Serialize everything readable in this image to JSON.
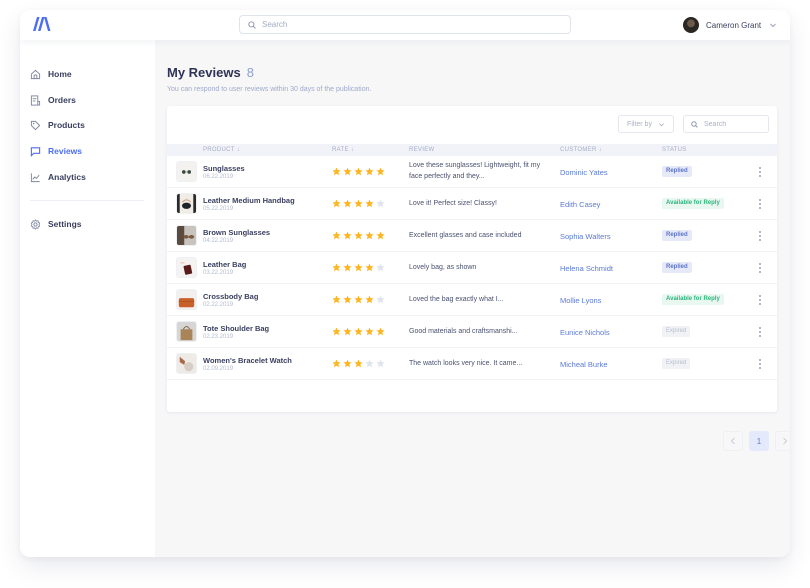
{
  "header": {
    "search_placeholder": "Search",
    "user_name": "Cameron Grant"
  },
  "sidebar": {
    "items": [
      {
        "label": "Home",
        "icon": "home-icon",
        "active": false
      },
      {
        "label": "Orders",
        "icon": "orders-icon",
        "active": false
      },
      {
        "label": "Products",
        "icon": "tag-icon",
        "active": false
      },
      {
        "label": "Reviews",
        "icon": "chat-icon",
        "active": true
      },
      {
        "label": "Analytics",
        "icon": "chart-icon",
        "active": false
      }
    ],
    "settings": {
      "label": "Settings",
      "icon": "gear-icon"
    }
  },
  "page": {
    "title": "My Reviews",
    "count": "8",
    "subtitle": "You can respond to user reviews within 30 days of the publication."
  },
  "toolbar": {
    "filter_label": "Filter by",
    "search_placeholder": "Search"
  },
  "table": {
    "columns": [
      {
        "label": "PRODUCT",
        "sortable": true
      },
      {
        "label": "RATE",
        "sortable": true
      },
      {
        "label": "REVIEW",
        "sortable": false
      },
      {
        "label": "CUSTOMER",
        "sortable": true
      },
      {
        "label": "STATUS",
        "sortable": false
      }
    ],
    "rows": [
      {
        "product": "Sunglasses",
        "date": "06.22.2019",
        "rating": 5,
        "review": "Love these sunglasses! Lightweight, fit my face perfectly and they...",
        "customer": "Dominic Yates",
        "status": "Replied",
        "status_type": "replied",
        "thumb": "sunglasses"
      },
      {
        "product": "Leather Medium Handbag",
        "date": "05.22.2019",
        "rating": 4,
        "review": "Love it! Perfect size! Classy!",
        "customer": "Edith Casey",
        "status": "Available for Reply",
        "status_type": "available",
        "thumb": "handbag"
      },
      {
        "product": "Brown Sunglasses",
        "date": "04.22.2019",
        "rating": 5,
        "review": "Excellent glasses and case included",
        "customer": "Sophia Walters",
        "status": "Replied",
        "status_type": "replied",
        "thumb": "brown-sunglasses"
      },
      {
        "product": "Leather Bag",
        "date": "03.22.2019",
        "rating": 4,
        "review": "Lovely bag, as shown",
        "customer": "Helena Schmidt",
        "status": "Replied",
        "status_type": "replied",
        "thumb": "leather-bag"
      },
      {
        "product": "Crossbody Bag",
        "date": "02.22.2019",
        "rating": 4,
        "review": "Loved the bag exactly what I...",
        "customer": "Mollie Lyons",
        "status": "Available for Reply",
        "status_type": "available",
        "thumb": "crossbody"
      },
      {
        "product": "Tote Shoulder Bag",
        "date": "02.23.2019",
        "rating": 5,
        "review": "Good materials and craftsmanshi...",
        "customer": "Eunice Nichols",
        "status": "Expired",
        "status_type": "expired",
        "thumb": "tote"
      },
      {
        "product": "Women's Bracelet Watch",
        "date": "02.09.2019",
        "rating": 3,
        "review": "The watch looks very nice. It came...",
        "customer": "Micheal Burke",
        "status": "Expired",
        "status_type": "expired",
        "thumb": "watch"
      }
    ]
  },
  "pagination": {
    "current_page": "1"
  },
  "colors": {
    "accent": "#4c6ef5",
    "star_filled": "#ffb422",
    "star_empty": "#dfe3ef"
  }
}
